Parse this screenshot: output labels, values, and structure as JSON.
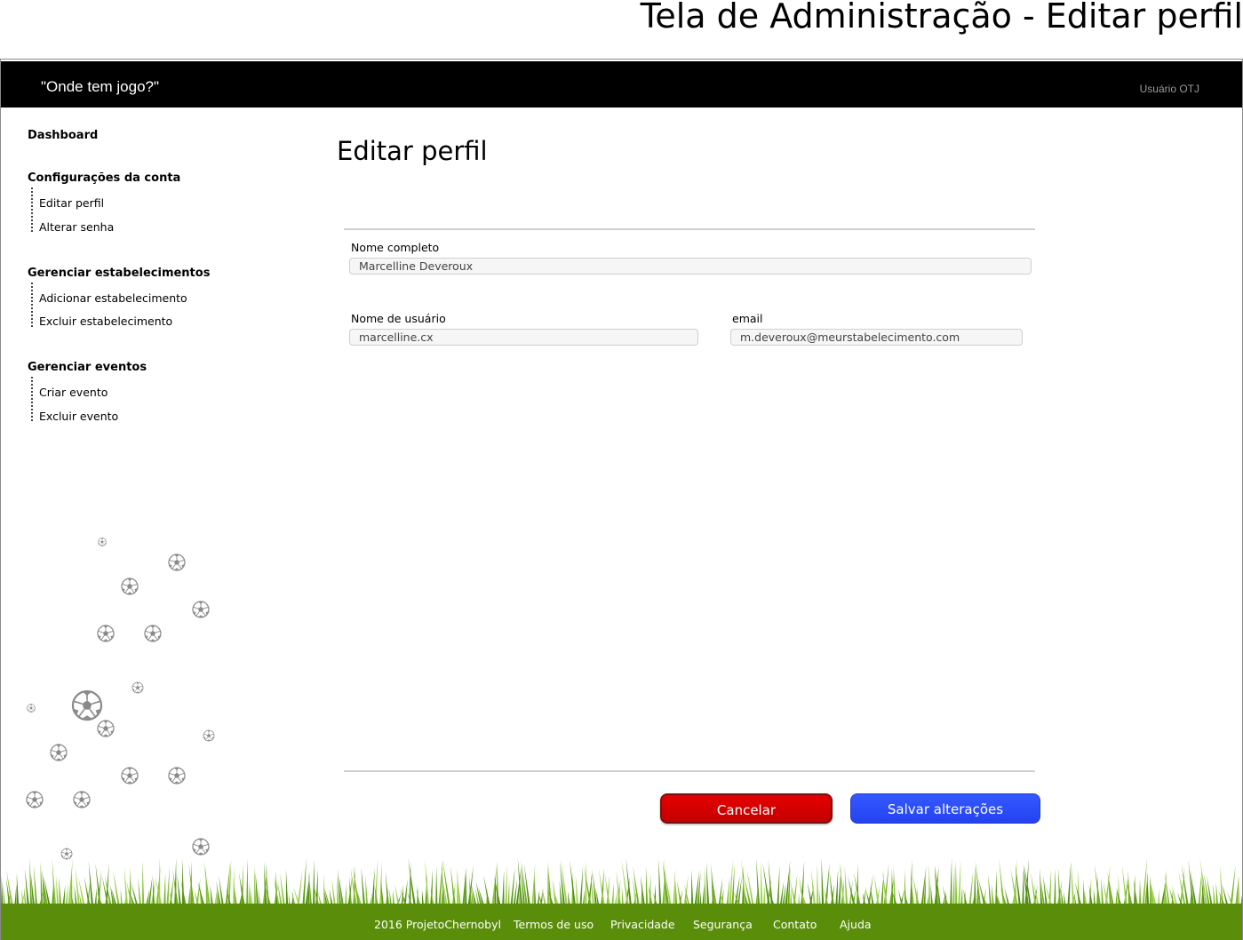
{
  "page": {
    "title": "Tela de Administração -  Editar perfil"
  },
  "header": {
    "brand": "\"Onde tem jogo?\"",
    "user": "Usuário OTJ"
  },
  "sidebar": {
    "dashboard": "Dashboard",
    "sections": [
      {
        "title": "Configurações da conta",
        "items": [
          "Editar perfil",
          "Alterar senha"
        ]
      },
      {
        "title": "Gerenciar estabelecimentos",
        "items": [
          "Adicionar estabelecimento",
          "Excluir estabelecimento"
        ]
      },
      {
        "title": "Gerenciar eventos",
        "items": [
          "Criar evento",
          "Excluir evento"
        ]
      }
    ]
  },
  "main": {
    "title": "Editar perfil",
    "fields": {
      "full_name": {
        "label": "Nome completo",
        "value": "Marcelline Deveroux"
      },
      "username": {
        "label": "Nome de usuário",
        "value": "marcelline.cx"
      },
      "email": {
        "label": "email",
        "value": "m.deveroux@meurstabelecimento.com"
      }
    },
    "buttons": {
      "cancel": "Cancelar",
      "save": "Salvar alterações"
    }
  },
  "footer": {
    "links": [
      "2016 ProjetoChernobyl",
      "Termos de uso",
      "Privacidade",
      "Segurança",
      "Contato",
      "Ajuda"
    ]
  },
  "colors": {
    "header_bg": "#000000",
    "cancel_button": "#d40000",
    "save_button": "#2d4cf7",
    "footer_bg": "#5a8d09",
    "grass": "#6fae1c"
  },
  "icons": [
    "soccer-ball-icon",
    "grass-decoration"
  ]
}
